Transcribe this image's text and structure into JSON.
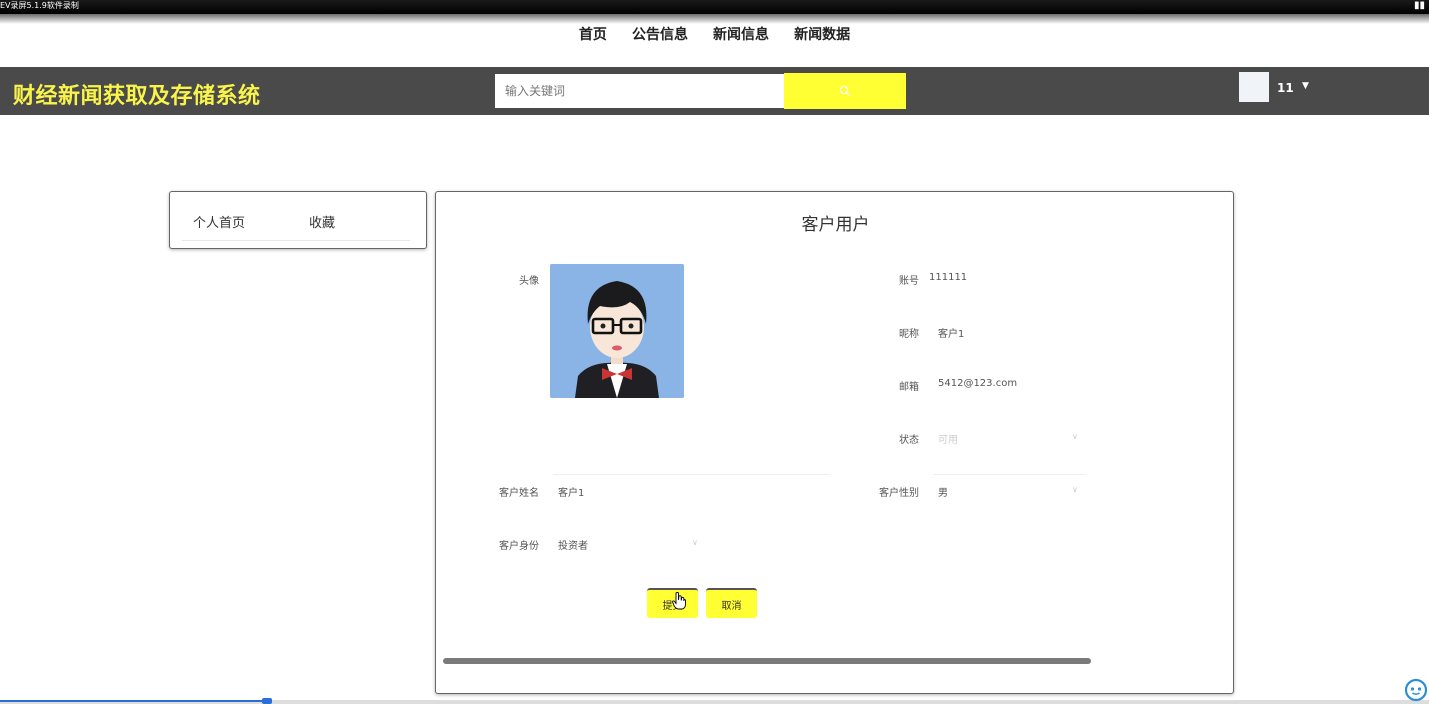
{
  "recorder": {
    "title": "EV录屏5.1.9软件录制"
  },
  "nav": {
    "items": [
      {
        "label": "首页"
      },
      {
        "label": "公告信息"
      },
      {
        "label": "新闻信息"
      },
      {
        "label": "新闻数据"
      }
    ]
  },
  "header": {
    "site_title": "财经新闻获取及存储系统",
    "search_placeholder": "输入关键词",
    "search_icon": "search-icon",
    "username": "11",
    "user_menu_icon": "caret-down-icon"
  },
  "sidebar": {
    "items": [
      {
        "label": "个人首页"
      },
      {
        "label": "收藏"
      }
    ]
  },
  "form": {
    "title": "客户用户",
    "avatar_label": "头像",
    "account_label": "账号",
    "account_value": "111111",
    "nickname_label": "昵称",
    "nickname_value": "客户1",
    "email_label": "邮箱",
    "email_value": "5412@123.com",
    "status_label": "状态",
    "status_value": "可用",
    "name_label": "客户姓名",
    "name_value": "客户1",
    "gender_label": "客户性别",
    "gender_value": "男",
    "identity_label": "客户身份",
    "identity_value": "投资者",
    "submit_label": "提交",
    "cancel_label": "取消"
  },
  "colors": {
    "accent_yellow": "#ffff33",
    "title_yellow": "#f9f44c",
    "header_bg": "#4a4a4a"
  }
}
